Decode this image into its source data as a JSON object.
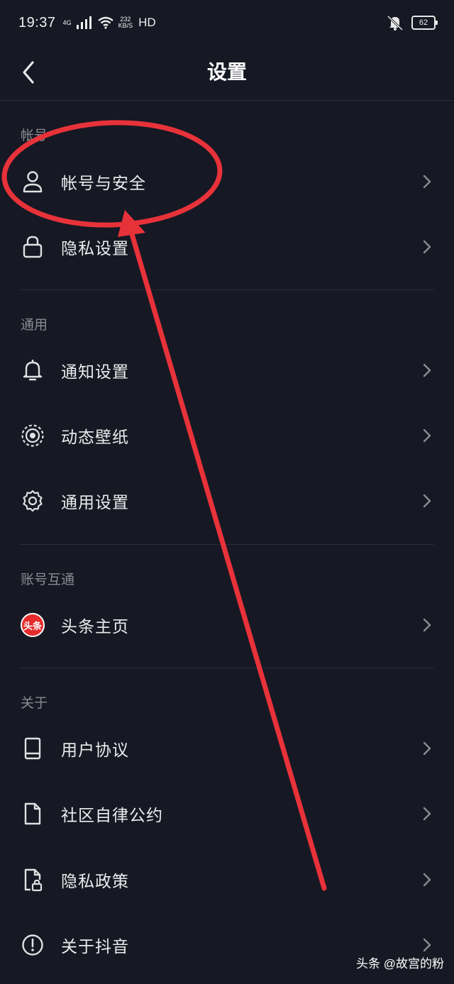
{
  "status_bar": {
    "time": "19:37",
    "network": "4G",
    "speed_value": "232",
    "speed_unit": "KB/S",
    "hd": "HD",
    "battery": "62"
  },
  "nav": {
    "title": "设置"
  },
  "sections": {
    "account": {
      "header": "帐号",
      "items": [
        {
          "label": "帐号与安全",
          "icon": "user-icon"
        },
        {
          "label": "隐私设置",
          "icon": "lock-icon"
        }
      ]
    },
    "general": {
      "header": "通用",
      "items": [
        {
          "label": "通知设置",
          "icon": "bell-icon"
        },
        {
          "label": "动态壁纸",
          "icon": "wallpaper-icon"
        },
        {
          "label": "通用设置",
          "icon": "gear-icon"
        }
      ]
    },
    "linked": {
      "header": "账号互通",
      "items": [
        {
          "label": "头条主页",
          "icon": "toutiao-logo-icon",
          "badge_text": "头条"
        }
      ]
    },
    "about": {
      "header": "关于",
      "items": [
        {
          "label": "用户协议",
          "icon": "book-icon"
        },
        {
          "label": "社区自律公约",
          "icon": "document-icon"
        },
        {
          "label": "隐私政策",
          "icon": "document-lock-icon"
        },
        {
          "label": "关于抖音",
          "icon": "info-icon"
        }
      ]
    }
  },
  "watermark": "头条 @故宫的粉",
  "colors": {
    "background": "#161823",
    "annotation_red": "#e8323a"
  }
}
